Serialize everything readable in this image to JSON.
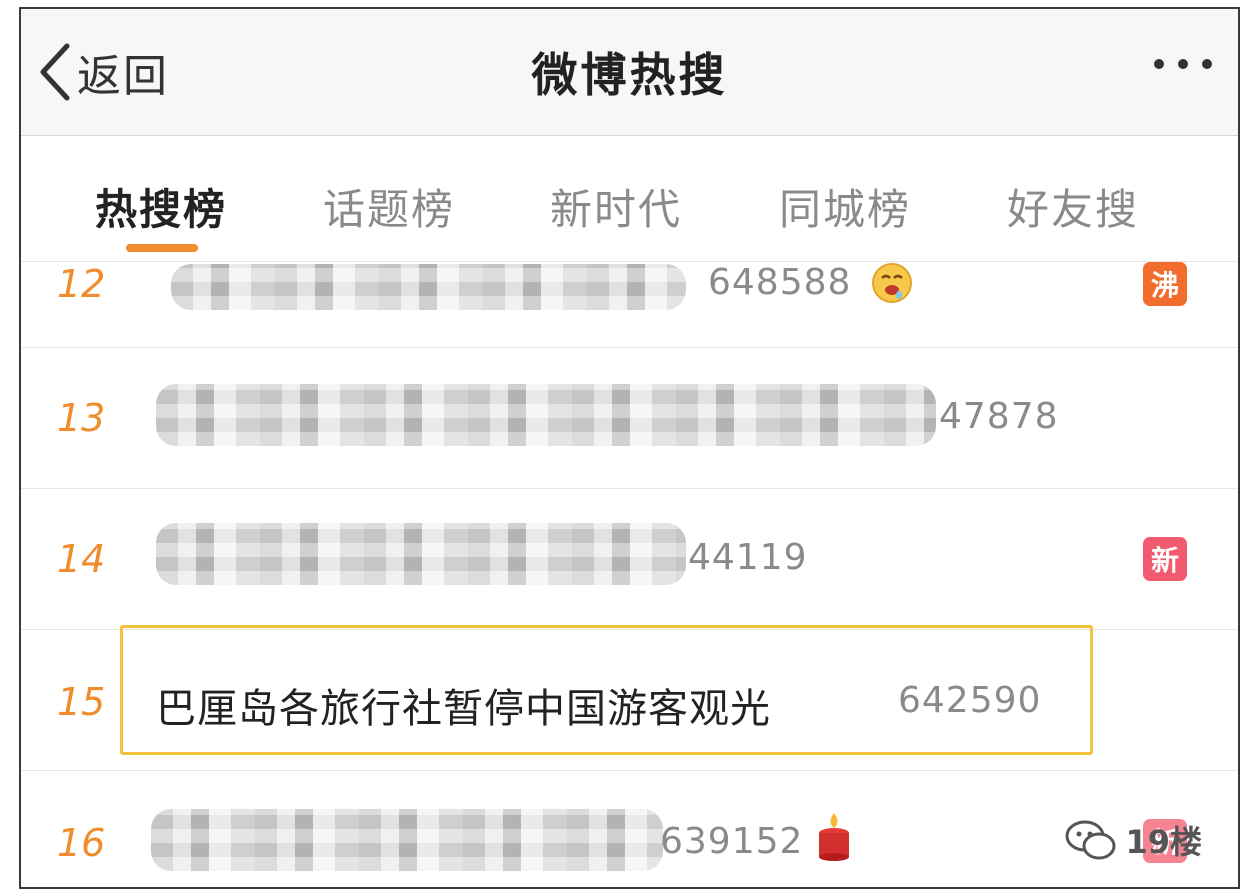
{
  "navbar": {
    "back_label": "返回",
    "title": "微博热搜"
  },
  "tabs": [
    {
      "label": "热搜榜",
      "active": true
    },
    {
      "label": "话题榜",
      "active": false
    },
    {
      "label": "新时代",
      "active": false
    },
    {
      "label": "同城榜",
      "active": false
    },
    {
      "label": "好友搜",
      "active": false
    }
  ],
  "rows": [
    {
      "rank": "12",
      "title_visible": "",
      "count": "648588",
      "emoji": "drooling-face-icon",
      "badge": "沸"
    },
    {
      "rank": "13",
      "title_visible": "",
      "count": "47878",
      "emoji": "",
      "badge": ""
    },
    {
      "rank": "14",
      "title_visible": "",
      "count": "44119",
      "emoji": "",
      "badge": "新"
    },
    {
      "rank": "15",
      "title_visible": "巴厘岛各旅行社暂停中国游客观光",
      "count": "642590",
      "emoji": "",
      "badge": ""
    },
    {
      "rank": "16",
      "title_visible": "",
      "count": "639152",
      "emoji": "candle-icon",
      "badge": "新"
    }
  ],
  "watermark": {
    "text": "19楼"
  },
  "colors": {
    "accent": "#f08c2c",
    "highlight": "#f2c33a",
    "boil_badge": "#f26c2b",
    "new_badge": "#f25a6e"
  }
}
